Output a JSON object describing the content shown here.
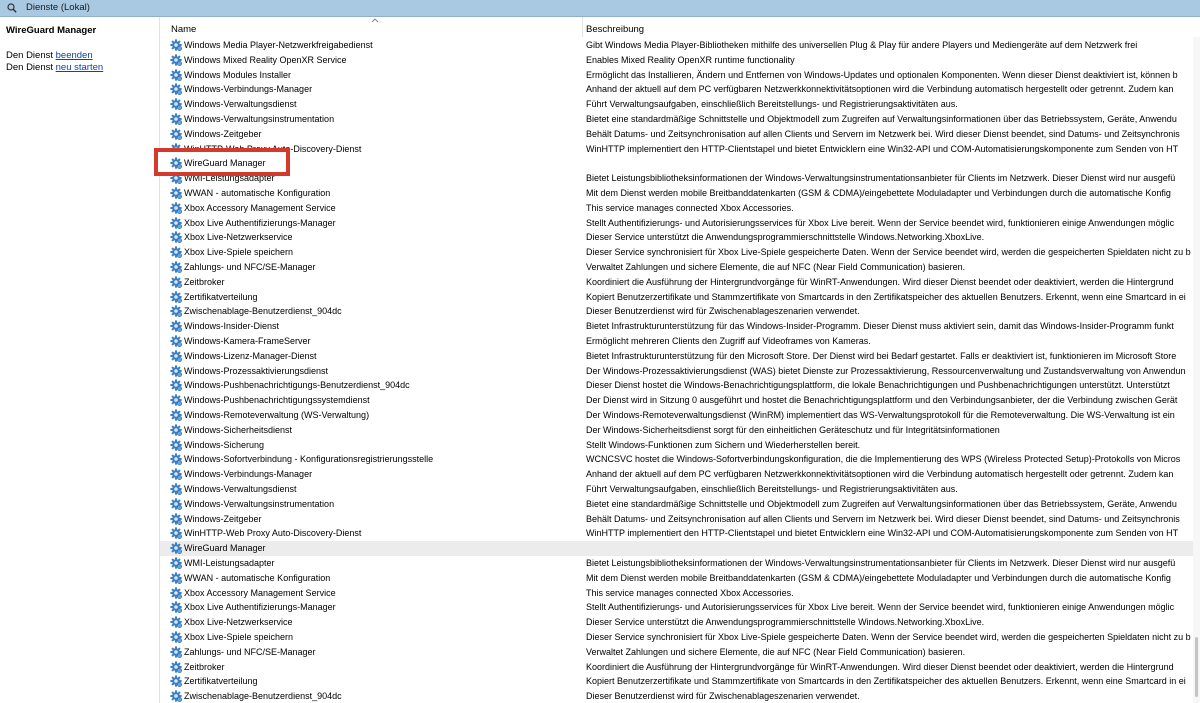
{
  "window": {
    "title": "Dienste (Lokal)"
  },
  "left_pane": {
    "title": "WireGuard Manager",
    "stop_prefix": "Den Dienst ",
    "stop_link": "beenden",
    "restart_prefix": "Den Dienst ",
    "restart_link": "neu starten"
  },
  "columns": {
    "name": "Name",
    "description": "Beschreibung"
  },
  "highlight": {
    "name": "WireGuard Manager",
    "color": "#d33a2c"
  },
  "colors": {
    "gear_blue": "#3a7fc4",
    "selected_row": "#ececec",
    "link": "#0645ad"
  },
  "rows": [
    {
      "name": "Windows Media Player-Netzwerkfreigabedienst",
      "desc": "Gibt Windows Media Player-Bibliotheken mithilfe des universellen Plug & Play für andere Players und Mediengeräte auf dem Netzwerk frei"
    },
    {
      "name": "Windows Mixed Reality OpenXR Service",
      "desc": "Enables Mixed Reality OpenXR runtime functionality"
    },
    {
      "name": "Windows Modules Installer",
      "desc": "Ermöglicht das Installieren, Ändern und Entfernen von Windows-Updates und optionalen Komponenten. Wenn dieser Dienst deaktiviert ist, können b"
    },
    {
      "name": "Windows-Verbindungs-Manager",
      "desc": "Anhand der aktuell auf dem PC verfügbaren Netzwerkkonnektivitätsoptionen wird die Verbindung automatisch hergestellt oder getrennt. Zudem kan"
    },
    {
      "name": "Windows-Verwaltungsdienst",
      "desc": "Führt Verwaltungsaufgaben, einschließlich Bereitstellungs- und Registrierungsaktivitäten aus."
    },
    {
      "name": "Windows-Verwaltungsinstrumentation",
      "desc": "Bietet eine standardmäßige Schnittstelle und Objektmodell zum Zugreifen auf Verwaltungsinformationen über das Betriebssystem, Geräte, Anwendu"
    },
    {
      "name": "Windows-Zeitgeber",
      "desc": "Behält Datums- und Zeitsynchronisation auf allen Clients und Servern im Netzwerk bei. Wird dieser Dienst beendet, sind Datums- und Zeitsynchronis"
    },
    {
      "name": "WinHTTP-Web Proxy Auto-Discovery-Dienst",
      "desc": "WinHTTP implementiert den HTTP-Clientstapel und bietet Entwicklern eine Win32-API und COM-Automatisierungskomponente zum Senden von HT"
    },
    {
      "name": "WireGuard Manager",
      "desc": ""
    },
    {
      "name": "WMI-Leistungsadapter",
      "desc": "Bietet Leistungsbibliotheksinformationen der Windows-Verwaltungsinstrumentationsanbieter für Clients im Netzwerk. Dieser Dienst wird nur ausgefü"
    },
    {
      "name": "WWAN - automatische Konfiguration",
      "desc": "Mit dem Dienst werden mobile Breitbanddatenkarten (GSM & CDMA)/eingebettete Moduladapter und Verbindungen durch die automatische Konfig"
    },
    {
      "name": "Xbox Accessory Management Service",
      "desc": "This service manages connected Xbox Accessories."
    },
    {
      "name": "Xbox Live Authentifizierungs-Manager",
      "desc": "Stellt Authentifizierungs- und Autorisierungsservices für Xbox Live bereit. Wenn der Service beendet wird, funktionieren einige Anwendungen möglic"
    },
    {
      "name": "Xbox Live-Netzwerkservice",
      "desc": "Dieser Service unterstützt die Anwendungsprogrammierschnittstelle Windows.Networking.XboxLive."
    },
    {
      "name": "Xbox Live-Spiele speichern",
      "desc": "Dieser Service synchronisiert für Xbox Live-Spiele gespeicherte Daten. Wenn der Service beendet wird, werden die gespeicherten Spieldaten nicht zu b"
    },
    {
      "name": "Zahlungs- und NFC/SE-Manager",
      "desc": "Verwaltet Zahlungen und sichere Elemente, die auf NFC (Near Field Communication) basieren."
    },
    {
      "name": "Zeitbroker",
      "desc": "Koordiniert die Ausführung der Hintergrundvorgänge für WinRT-Anwendungen. Wird dieser Dienst beendet oder deaktiviert, werden die Hintergrund"
    },
    {
      "name": "Zertifikatverteilung",
      "desc": "Kopiert Benutzerzertifikate und Stammzertifikate von Smartcards in den Zertifikatspeicher des aktuellen Benutzers. Erkennt, wenn eine Smartcard in ei"
    },
    {
      "name": "Zwischenablage-Benutzerdienst_904dc",
      "desc": "Dieser Benutzerdienst wird für Zwischenablageszenarien verwendet."
    },
    {
      "name": "Windows-Insider-Dienst",
      "desc": "Bietet Infrastrukturunterstützung für das Windows-Insider-Programm. Dieser Dienst muss aktiviert sein, damit das Windows-Insider-Programm funkt"
    },
    {
      "name": "Windows-Kamera-FrameServer",
      "desc": "Ermöglicht mehreren Clients den Zugriff auf Videoframes von Kameras."
    },
    {
      "name": "Windows-Lizenz-Manager-Dienst",
      "desc": "Bietet Infrastrukturunterstützung für den Microsoft Store. Der Dienst wird bei Bedarf gestartet. Falls er deaktiviert ist, funktionieren im Microsoft Store"
    },
    {
      "name": "Windows-Prozessaktivierungsdienst",
      "desc": "Der Windows-Prozessaktivierungsdienst (WAS) bietet Dienste zur Prozessaktivierung, Ressourcenverwaltung und Zustandsverwaltung von Anwendun"
    },
    {
      "name": "Windows-Pushbenachrichtigungs-Benutzerdienst_904dc",
      "desc": "Dieser Dienst hostet die Windows-Benachrichtigungsplattform, die lokale Benachrichtigungen und Pushbenachrichtigungen unterstützt. Unterstützt"
    },
    {
      "name": "Windows-Pushbenachrichtigungssystemdienst",
      "desc": "Der Dienst wird in Sitzung 0 ausgeführt und hostet die Benachrichtigungsplattform und den Verbindungsanbieter, der die Verbindung zwischen Gerät"
    },
    {
      "name": "Windows-Remoteverwaltung (WS-Verwaltung)",
      "desc": "Der Windows-Remoteverwaltungsdienst (WinRM) implementiert das WS-Verwaltungsprotokoll für die Remoteverwaltung. Die WS-Verwaltung ist ein"
    },
    {
      "name": "Windows-Sicherheitsdienst",
      "desc": "Der Windows-Sicherheitsdienst sorgt für den einheitlichen Geräteschutz und für Integritätsinformationen"
    },
    {
      "name": "Windows-Sicherung",
      "desc": "Stellt Windows-Funktionen zum Sichern und Wiederherstellen bereit."
    },
    {
      "name": "Windows-Sofortverbindung - Konfigurationsregistrierungsstelle",
      "desc": "WCNCSVC hostet die Windows-Sofortverbindungskonfiguration, die die Implementierung des WPS (Wireless Protected Setup)-Protokolls von Micros"
    },
    {
      "name": "Windows-Verbindungs-Manager",
      "desc": "Anhand der aktuell auf dem PC verfügbaren Netzwerkkonnektivitätsoptionen wird die Verbindung automatisch hergestellt oder getrennt. Zudem kan"
    },
    {
      "name": "Windows-Verwaltungsdienst",
      "desc": "Führt Verwaltungsaufgaben, einschließlich Bereitstellungs- und Registrierungsaktivitäten aus."
    },
    {
      "name": "Windows-Verwaltungsinstrumentation",
      "desc": "Bietet eine standardmäßige Schnittstelle und Objektmodell zum Zugreifen auf Verwaltungsinformationen über das Betriebssystem, Geräte, Anwendu"
    },
    {
      "name": "Windows-Zeitgeber",
      "desc": "Behält Datums- und Zeitsynchronisation auf allen Clients und Servern im Netzwerk bei. Wird dieser Dienst beendet, sind Datums- und Zeitsynchronis"
    },
    {
      "name": "WinHTTP-Web Proxy Auto-Discovery-Dienst",
      "desc": "WinHTTP implementiert den HTTP-Clientstapel und bietet Entwicklern eine Win32-API und COM-Automatisierungskomponente zum Senden von HT"
    },
    {
      "name": "WireGuard Manager",
      "desc": ""
    },
    {
      "name": "WMI-Leistungsadapter",
      "desc": "Bietet Leistungsbibliotheksinformationen der Windows-Verwaltungsinstrumentationsanbieter für Clients im Netzwerk. Dieser Dienst wird nur ausgefü"
    },
    {
      "name": "WWAN - automatische Konfiguration",
      "desc": "Mit dem Dienst werden mobile Breitbanddatenkarten (GSM & CDMA)/eingebettete Moduladapter und Verbindungen durch die automatische Konfig"
    },
    {
      "name": "Xbox Accessory Management Service",
      "desc": "This service manages connected Xbox Accessories."
    },
    {
      "name": "Xbox Live Authentifizierungs-Manager",
      "desc": "Stellt Authentifizierungs- und Autorisierungsservices für Xbox Live bereit. Wenn der Service beendet wird, funktionieren einige Anwendungen möglic"
    },
    {
      "name": "Xbox Live-Netzwerkservice",
      "desc": "Dieser Service unterstützt die Anwendungsprogrammierschnittstelle Windows.Networking.XboxLive."
    },
    {
      "name": "Xbox Live-Spiele speichern",
      "desc": "Dieser Service synchronisiert für Xbox Live-Spiele gespeicherte Daten. Wenn der Service beendet wird, werden die gespeicherten Spieldaten nicht zu b"
    },
    {
      "name": "Zahlungs- und NFC/SE-Manager",
      "desc": "Verwaltet Zahlungen und sichere Elemente, die auf NFC (Near Field Communication) basieren."
    },
    {
      "name": "Zeitbroker",
      "desc": "Koordiniert die Ausführung der Hintergrundvorgänge für WinRT-Anwendungen. Wird dieser Dienst beendet oder deaktiviert, werden die Hintergrund"
    },
    {
      "name": "Zertifikatverteilung",
      "desc": "Kopiert Benutzerzertifikate und Stammzertifikate von Smartcards in den Zertifikatspeicher des aktuellen Benutzers. Erkennt, wenn eine Smartcard in ei"
    },
    {
      "name": "Zwischenablage-Benutzerdienst_904dc",
      "desc": "Dieser Benutzerdienst wird für Zwischenablageszenarien verwendet."
    }
  ],
  "selected_row_index": 34
}
